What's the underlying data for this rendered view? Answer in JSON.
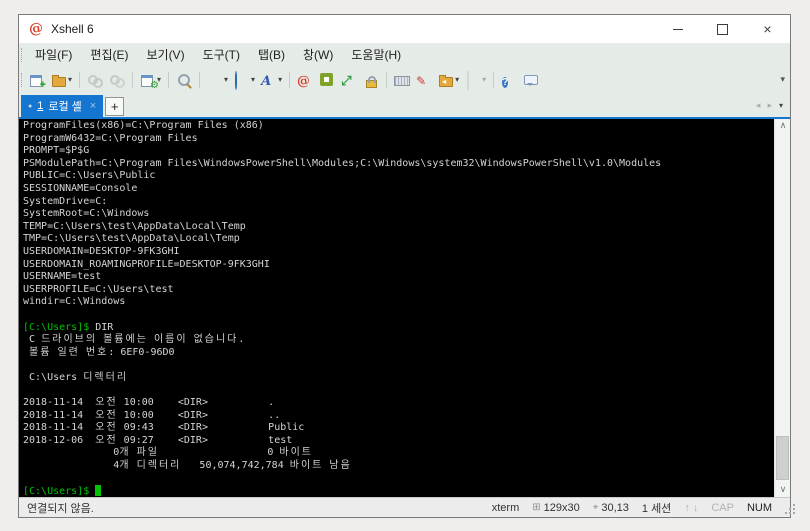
{
  "colors": {
    "accent_blue": "#1576d2",
    "chrome_bg": "#e5ebe7",
    "terminal_bg": "#000000",
    "terminal_fg": "#d4d4d4",
    "terminal_green": "#00c200",
    "xshell_red": "#d6402c"
  },
  "titlebar": {
    "title": "Xshell 6"
  },
  "menubar": {
    "items": [
      {
        "label": "파일(F)"
      },
      {
        "label": "편집(E)"
      },
      {
        "label": "보기(V)"
      },
      {
        "label": "도구(T)"
      },
      {
        "label": "탭(B)"
      },
      {
        "label": "창(W)"
      },
      {
        "label": "도움말(H)"
      }
    ]
  },
  "tabbar": {
    "tabs": [
      {
        "number": "1",
        "label": "로컬 셸"
      }
    ]
  },
  "icons": {
    "close": "×",
    "dropdown": "▾",
    "tab_close": "×",
    "new_tab": "+",
    "nav_left": "◂",
    "nav_right": "▸",
    "scroll_up": "∧",
    "scroll_down": "∨",
    "font": "A",
    "pen": "✎",
    "fullscreen": "⤢",
    "xshell_swirl": "@",
    "help": "?",
    "gear": "⚙",
    "plus_badge": "+",
    "transfer_arrow": "◂",
    "arrow_up": "↑",
    "arrow_down": "↓",
    "size_icon": "⊞",
    "position_icon": "⌖",
    "session_dot": "●"
  },
  "terminal": {
    "lines": [
      {
        "segments": [
          {
            "text": "ProgramFiles(x86)=C:\\Program Files (x86)"
          }
        ]
      },
      {
        "segments": [
          {
            "text": "ProgramW6432=C:\\Program Files"
          }
        ]
      },
      {
        "segments": [
          {
            "text": "PROMPT=$P$G"
          }
        ]
      },
      {
        "segments": [
          {
            "text": "PSModulePath=C:\\Program Files\\WindowsPowerShell\\Modules;C:\\Windows\\system32\\WindowsPowerShell\\v1.0\\Modules"
          }
        ]
      },
      {
        "segments": [
          {
            "text": "PUBLIC=C:\\Users\\Public"
          }
        ]
      },
      {
        "segments": [
          {
            "text": "SESSIONNAME=Console"
          }
        ]
      },
      {
        "segments": [
          {
            "text": "SystemDrive=C:"
          }
        ]
      },
      {
        "segments": [
          {
            "text": "SystemRoot=C:\\Windows"
          }
        ]
      },
      {
        "segments": [
          {
            "text": "TEMP=C:\\Users\\test\\AppData\\Local\\Temp"
          }
        ]
      },
      {
        "segments": [
          {
            "text": "TMP=C:\\Users\\test\\AppData\\Local\\Temp"
          }
        ]
      },
      {
        "segments": [
          {
            "text": "USERDOMAIN=DESKTOP-9FK3GHI"
          }
        ]
      },
      {
        "segments": [
          {
            "text": "USERDOMAIN_ROAMINGPROFILE=DESKTOP-9FK3GHI"
          }
        ]
      },
      {
        "segments": [
          {
            "text": "USERNAME=test"
          }
        ]
      },
      {
        "segments": [
          {
            "text": "USERPROFILE=C:\\Users\\test"
          }
        ]
      },
      {
        "segments": [
          {
            "text": "windir=C:\\Windows"
          }
        ]
      },
      {
        "segments": []
      },
      {
        "segments": [
          {
            "text": "[C:\\Users]$",
            "color": "green"
          },
          {
            "text": " DIR"
          }
        ]
      },
      {
        "segments": [
          {
            "text": " C 드라이브의 볼륨에는 이름이 없습니다."
          }
        ]
      },
      {
        "segments": [
          {
            "text": " 볼륨 일련 번호: 6EF0-96D0"
          }
        ]
      },
      {
        "segments": []
      },
      {
        "segments": [
          {
            "text": " C:\\Users 디렉터리"
          }
        ]
      },
      {
        "segments": []
      },
      {
        "segments": [
          {
            "text": "2018-11-14  오전 10:00    <DIR>          ."
          }
        ]
      },
      {
        "segments": [
          {
            "text": "2018-11-14  오전 10:00    <DIR>          .."
          }
        ]
      },
      {
        "segments": [
          {
            "text": "2018-11-14  오전 09:43    <DIR>          Public"
          }
        ]
      },
      {
        "segments": [
          {
            "text": "2018-12-06  오전 09:27    <DIR>          test"
          }
        ]
      },
      {
        "segments": [
          {
            "text": "               0개 파일                  0 바이트"
          }
        ]
      },
      {
        "segments": [
          {
            "text": "               4개 디렉터리   50,074,742,784 바이트 남음"
          }
        ]
      },
      {
        "segments": []
      },
      {
        "segments": [
          {
            "text": "[C:\\Users]$",
            "color": "green"
          },
          {
            "text": " "
          },
          {
            "cursor": true
          }
        ]
      }
    ]
  },
  "statusbar": {
    "connection": "연결되지 않음.",
    "terminal_type": "xterm",
    "size": "129x30",
    "cursor_position": "30,13",
    "sessions": "1 세션",
    "caps_lock": "CAP",
    "num_lock": "NUM"
  }
}
